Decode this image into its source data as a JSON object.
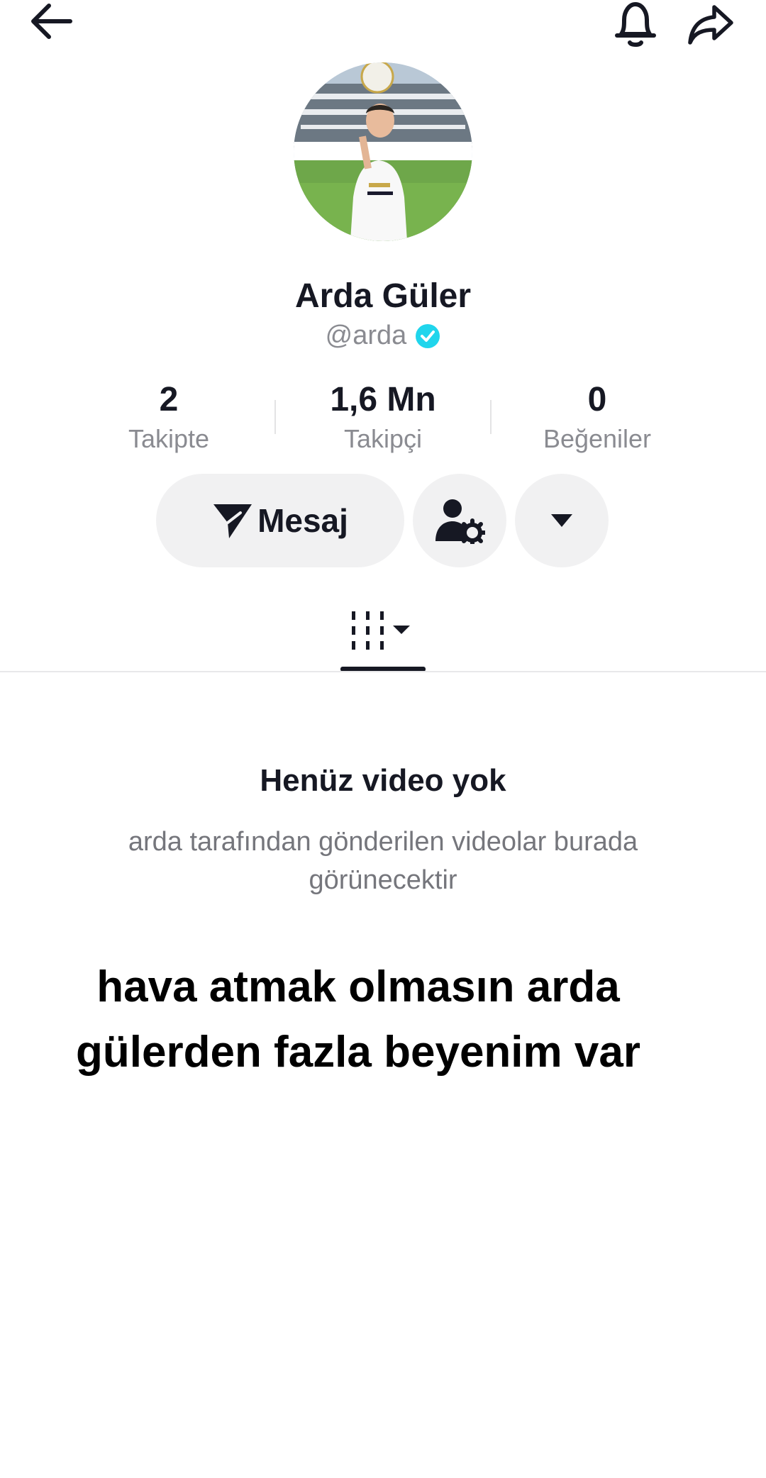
{
  "header": {
    "back_icon": "arrow-left-icon",
    "bell_icon": "bell-icon",
    "share_icon": "share-arrow-icon"
  },
  "profile": {
    "avatar_icon": "profile-photo",
    "display_name": "Arda Güler",
    "username": "@arda",
    "verified_icon": "verified-check-icon",
    "verified_color": "#20d5ec"
  },
  "stats": [
    {
      "value": "2",
      "label": "Takipte"
    },
    {
      "value": "1,6 Mn",
      "label": "Takipçi"
    },
    {
      "value": "0",
      "label": "Beğeniler"
    }
  ],
  "actions": {
    "message_label": "Mesaj",
    "message_icon": "send-message-icon",
    "friend_settings_icon": "user-settings-icon",
    "more_icon": "caret-down-icon"
  },
  "tabs": {
    "videos_icon": "video-grid-icon"
  },
  "empty_state": {
    "title": "Henüz video yok",
    "description": "arda tarafından gönderilen videolar burada görünecektir"
  },
  "overlay_caption": "hava atmak olmasın arda gülerden fazla beyenim var"
}
